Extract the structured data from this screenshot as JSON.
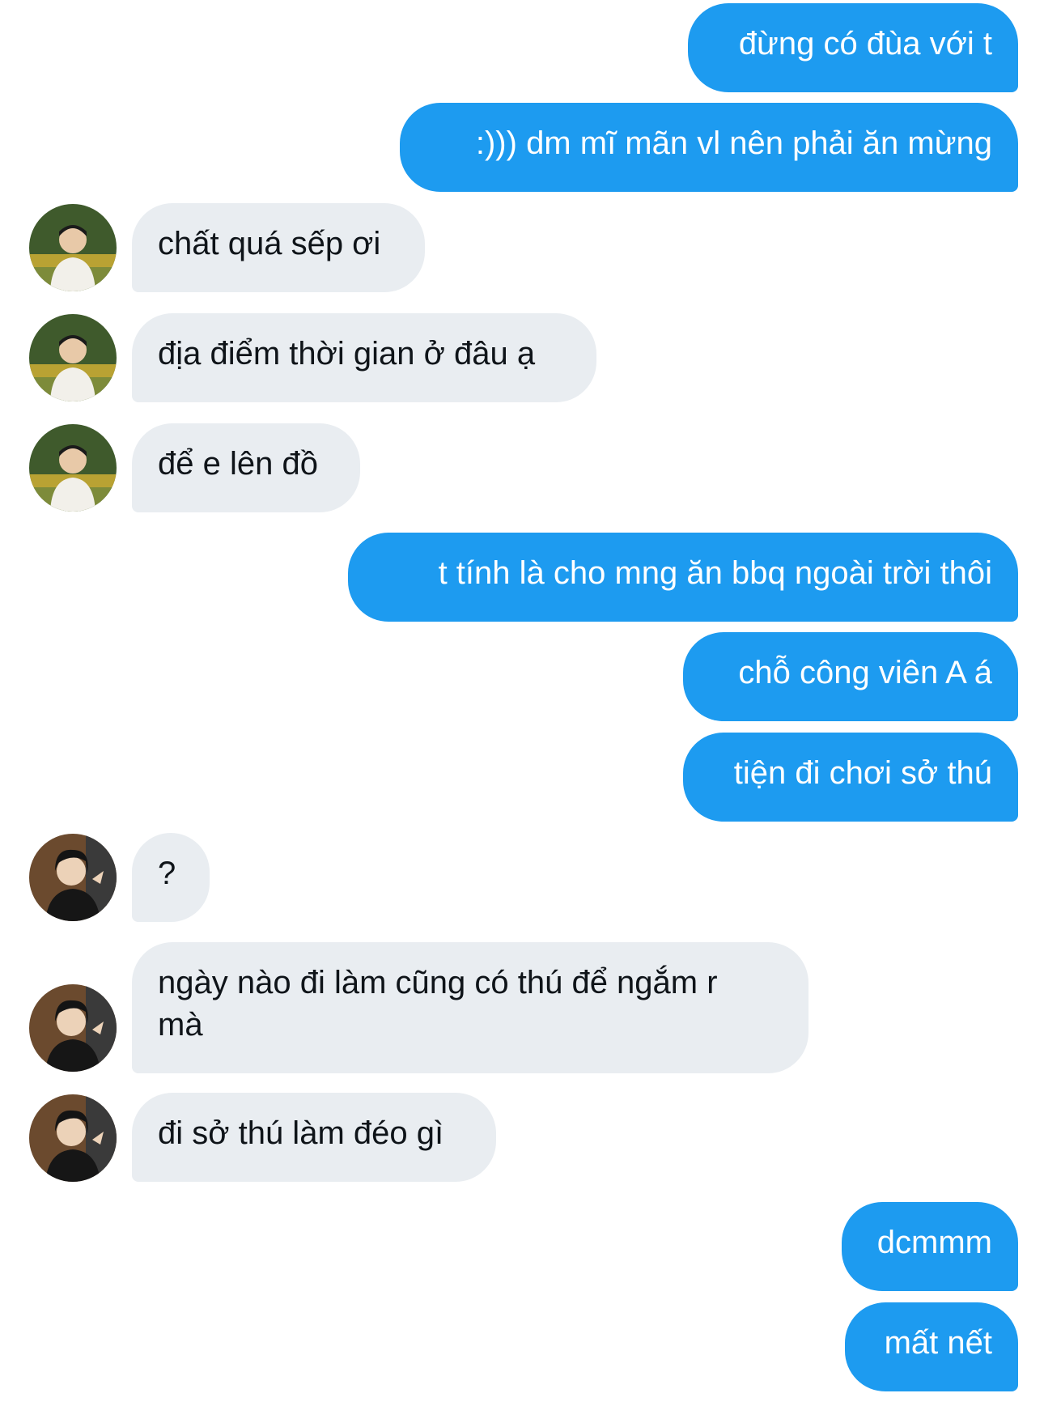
{
  "thread": {
    "messages": [
      {
        "side": "sent",
        "text": "đừng có đùa với t"
      },
      {
        "side": "sent",
        "text": ":))) dm mĩ mãn vl nên phải ăn mừng"
      },
      {
        "side": "received",
        "sender": "user-a",
        "text": "chất quá sếp ơi"
      },
      {
        "side": "received",
        "sender": "user-a",
        "text": "địa điểm thời gian ở đâu ạ"
      },
      {
        "side": "received",
        "sender": "user-a",
        "text": "để e lên đồ"
      },
      {
        "side": "sent",
        "text": "t tính là cho mng ăn bbq ngoài trời thôi"
      },
      {
        "side": "sent",
        "text": "chỗ công viên A á"
      },
      {
        "side": "sent",
        "text": "tiện đi chơi sở thú"
      },
      {
        "side": "received",
        "sender": "user-b",
        "text": "?"
      },
      {
        "side": "received",
        "sender": "user-b",
        "text": "ngày nào đi làm cũng có thú để ngắm r\nmà"
      },
      {
        "side": "received",
        "sender": "user-b",
        "text": "đi sở thú làm đéo gì"
      },
      {
        "side": "sent",
        "text": "dcmmm"
      },
      {
        "side": "sent",
        "text": "mất nết"
      }
    ]
  },
  "colors": {
    "sent_bubble": "#1d9bf0",
    "sent_text": "#ffffff",
    "received_bubble": "#e9edf1",
    "received_text": "#0f1419",
    "background": "#ffffff"
  },
  "icons": {
    "user_a_avatar": "avatar-user-a-icon",
    "user_b_avatar": "avatar-user-b-icon"
  }
}
